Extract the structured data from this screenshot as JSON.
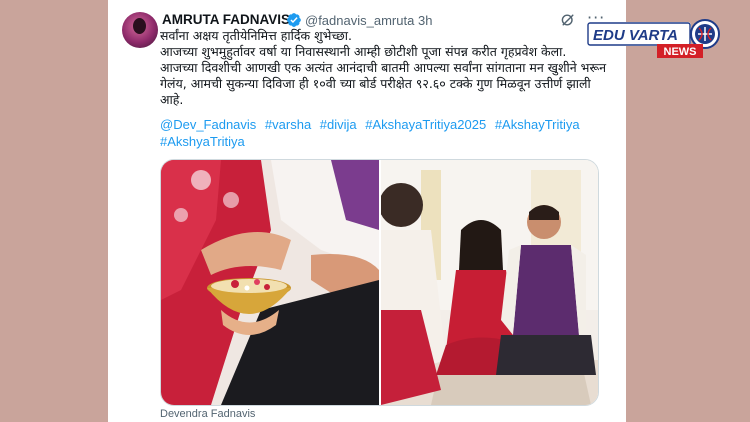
{
  "tweet": {
    "author_name": "AMRUTA FADNAVIS",
    "handle": "@fadnavis_amruta",
    "separator": "·",
    "time": "3h",
    "more": "···",
    "lines": [
      "सर्वांना अक्षय तृतीयेनिमित्त हार्दिक शुभेच्छा.",
      "आजच्या शुभमुहुर्तावर वर्षा या निवासस्थानी आम्ही छोटीशी पूजा संपन्न करीत गृहप्रवेश केला.",
      "आजच्या दिवशीची आणखी एक अत्यंत आनंदाची बातमी आपल्या सर्वांना सांगताना मन खुशीने भरून गेलंय, आमची सुकन्या दिविजा ही १०वी च्या बोर्ड परीक्षेत ९२.६० टक्के गुण मिळवून उत्तीर्ण झाली आहे."
    ],
    "hashtags": [
      "@Dev_Fadnavis",
      "#varsha",
      "#divija",
      "#AkshayaTritiya2025",
      "#AkshayTritiya",
      "#AkshyaTritiya"
    ],
    "media_caption": "Devendra Fadnavis"
  },
  "logo": {
    "line1": "EDU VARTA",
    "line2": "NEWS"
  },
  "colors": {
    "background": "#c9a49b",
    "link": "#1d9bf0",
    "verified": "#1d9bf0",
    "logo_blue": "#1f3c88",
    "logo_red": "#d32027"
  },
  "icons": [
    "verified-badge-icon",
    "grok-icon",
    "more-icon"
  ]
}
